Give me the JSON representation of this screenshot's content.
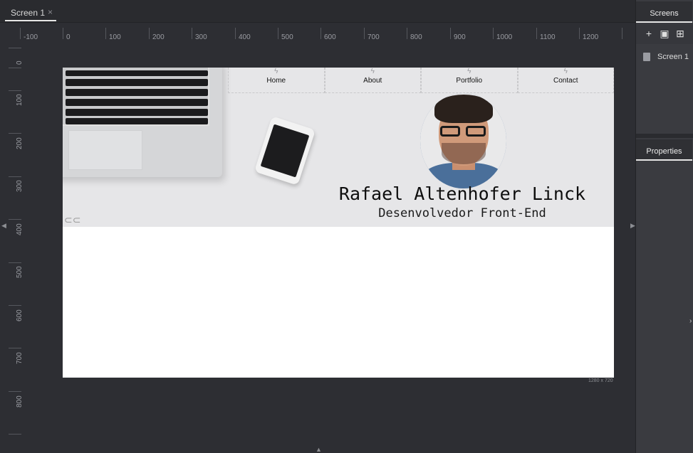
{
  "tab": {
    "label": "Screen 1",
    "close": "×"
  },
  "ruler": {
    "h_labels": [
      "-100",
      "0",
      "100",
      "200",
      "300",
      "400",
      "500",
      "600",
      "700",
      "800",
      "900",
      "1000",
      "1100",
      "1200"
    ],
    "v_labels": [
      "0",
      "100",
      "200",
      "300",
      "400",
      "500",
      "600",
      "700",
      "800"
    ]
  },
  "nav": {
    "items": [
      "Home",
      "About",
      "Portfolio",
      "Contact"
    ]
  },
  "hero": {
    "name": "Rafael Altenhofer Linck",
    "subtitle": "Desenvolvedor Front-End"
  },
  "artboard": {
    "size_label": "1280 x 720"
  },
  "right_panel": {
    "screens_tab": "Screens",
    "properties_tab": "Properties",
    "screen_item": "Screen 1",
    "tools": [
      "plus-icon",
      "image-icon",
      "folder-add-icon"
    ]
  },
  "colors": {
    "canvas": "#2d2e33",
    "panel": "#3a3b40",
    "hero_bg": "#e6e6e8"
  }
}
